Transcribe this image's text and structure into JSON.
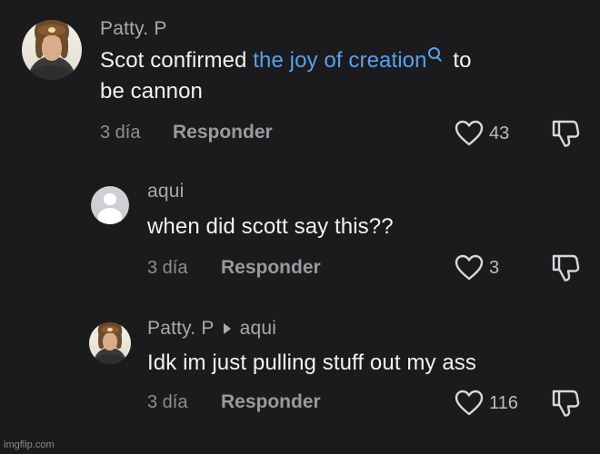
{
  "comments": [
    {
      "username": "Patty. P",
      "text_before": "Scot confirmed ",
      "link_text": "the joy of creation",
      "text_after": " to",
      "text_line2": "be cannon",
      "date": "3 día",
      "reply_label": "Responder",
      "likes": "43"
    },
    {
      "username": "aqui",
      "text": "when did scott say this??",
      "date": "3 día",
      "reply_label": "Responder",
      "likes": "3"
    },
    {
      "username": "Patty. P",
      "reply_to": "aqui",
      "text": "Idk im just pulling stuff out my ass",
      "date": "3 día",
      "reply_label": "Responder",
      "likes": "116"
    }
  ],
  "watermark": "imgflip.com",
  "colors": {
    "background": "#1b1b1d",
    "link": "#5aa0ee",
    "username": "#a9a9ad",
    "text": "#f2f2f2"
  },
  "icons": [
    "heart-outline-icon",
    "thumbs-down-outline-icon",
    "search-icon",
    "caret-right-icon",
    "default-avatar-icon"
  ]
}
